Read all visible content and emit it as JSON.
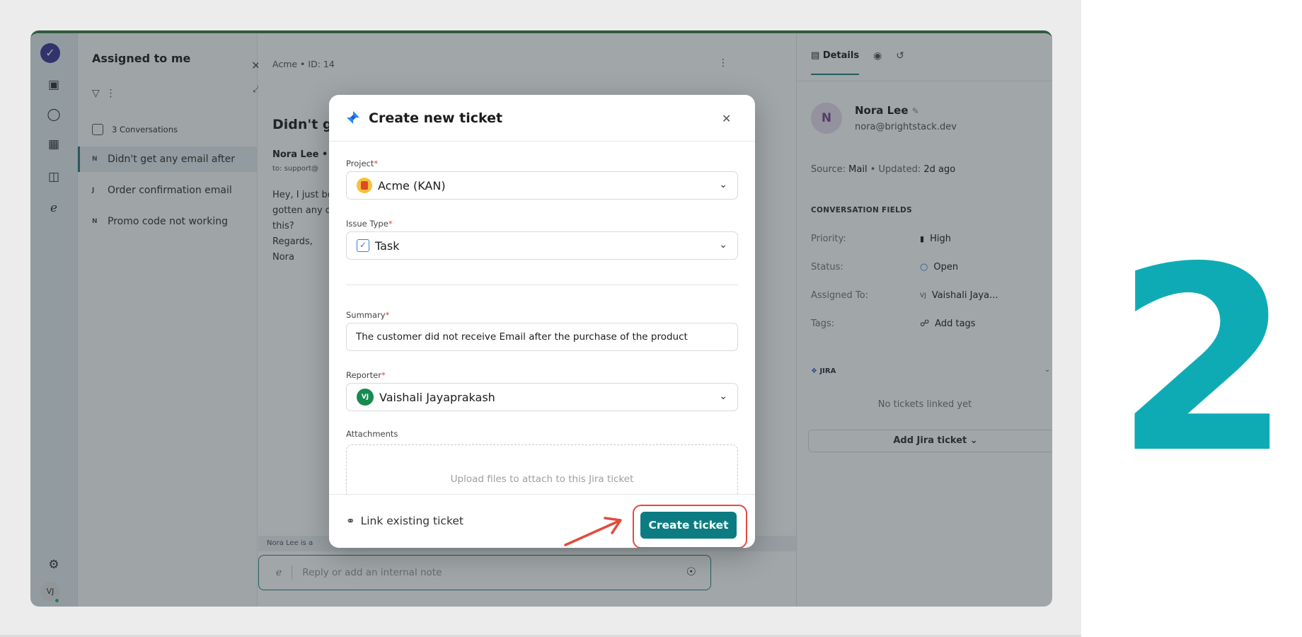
{
  "step_number": "2",
  "rail": {
    "logo": "✓",
    "avatar": "VJ"
  },
  "list": {
    "title": "Assigned to me",
    "count_label": "3 Conversations",
    "items": [
      {
        "initial": "N",
        "label": "Didn't get any email after"
      },
      {
        "initial": "J",
        "label": "Order confirmation email"
      },
      {
        "initial": "N",
        "label": "Promo code not working"
      }
    ]
  },
  "conversation": {
    "breadcrumb": "Acme • ID: 14",
    "title": "Didn't ge",
    "sender": "Nora Lee  •",
    "to": "to: support@",
    "body": [
      "Hey, I just bo",
      "gotten any c",
      "this?",
      "Regards,",
      "Nora"
    ],
    "typing": "Nora Lee is a",
    "reply_placeholder": "Reply or add an internal note"
  },
  "details": {
    "tab_label": "Details",
    "name": "Nora Lee",
    "email": "nora@brightstack.dev",
    "source_label": "Source:",
    "source_value": "Mail",
    "updated_label": "•  Updated:",
    "updated_value": "2d ago",
    "section_title": "CONVERSATION FIELDS",
    "fields": [
      {
        "key": "Priority:",
        "value": "High"
      },
      {
        "key": "Status:",
        "value": "Open"
      },
      {
        "key": "Assigned To:",
        "value": "Vaishali Jaya..."
      },
      {
        "key": "Tags:",
        "value": "Add tags"
      }
    ],
    "assignee_initials": "VJ",
    "jira_title": "JIRA",
    "no_tickets": "No tickets linked yet",
    "add_jira": "Add Jira ticket ⌄"
  },
  "modal": {
    "title": "Create new ticket",
    "project_label": "Project",
    "project_value": "Acme (KAN)",
    "issue_label": "Issue Type",
    "issue_value": "Task",
    "summary_label": "Summary",
    "summary_value": "The customer did not receive Email after the purchase of the product",
    "reporter_label": "Reporter",
    "reporter_initials": "VJ",
    "reporter_value": "Vaishali Jayaprakash",
    "attachments_label": "Attachments",
    "upload_text": "Upload files to attach to this Jira ticket",
    "link_existing": "Link existing ticket",
    "create_button": "Create ticket",
    "required_mark": "*"
  },
  "colors": {
    "accent": "#0c7c82",
    "step_number": "#0fabb5",
    "highlight": "#e14b3c"
  }
}
